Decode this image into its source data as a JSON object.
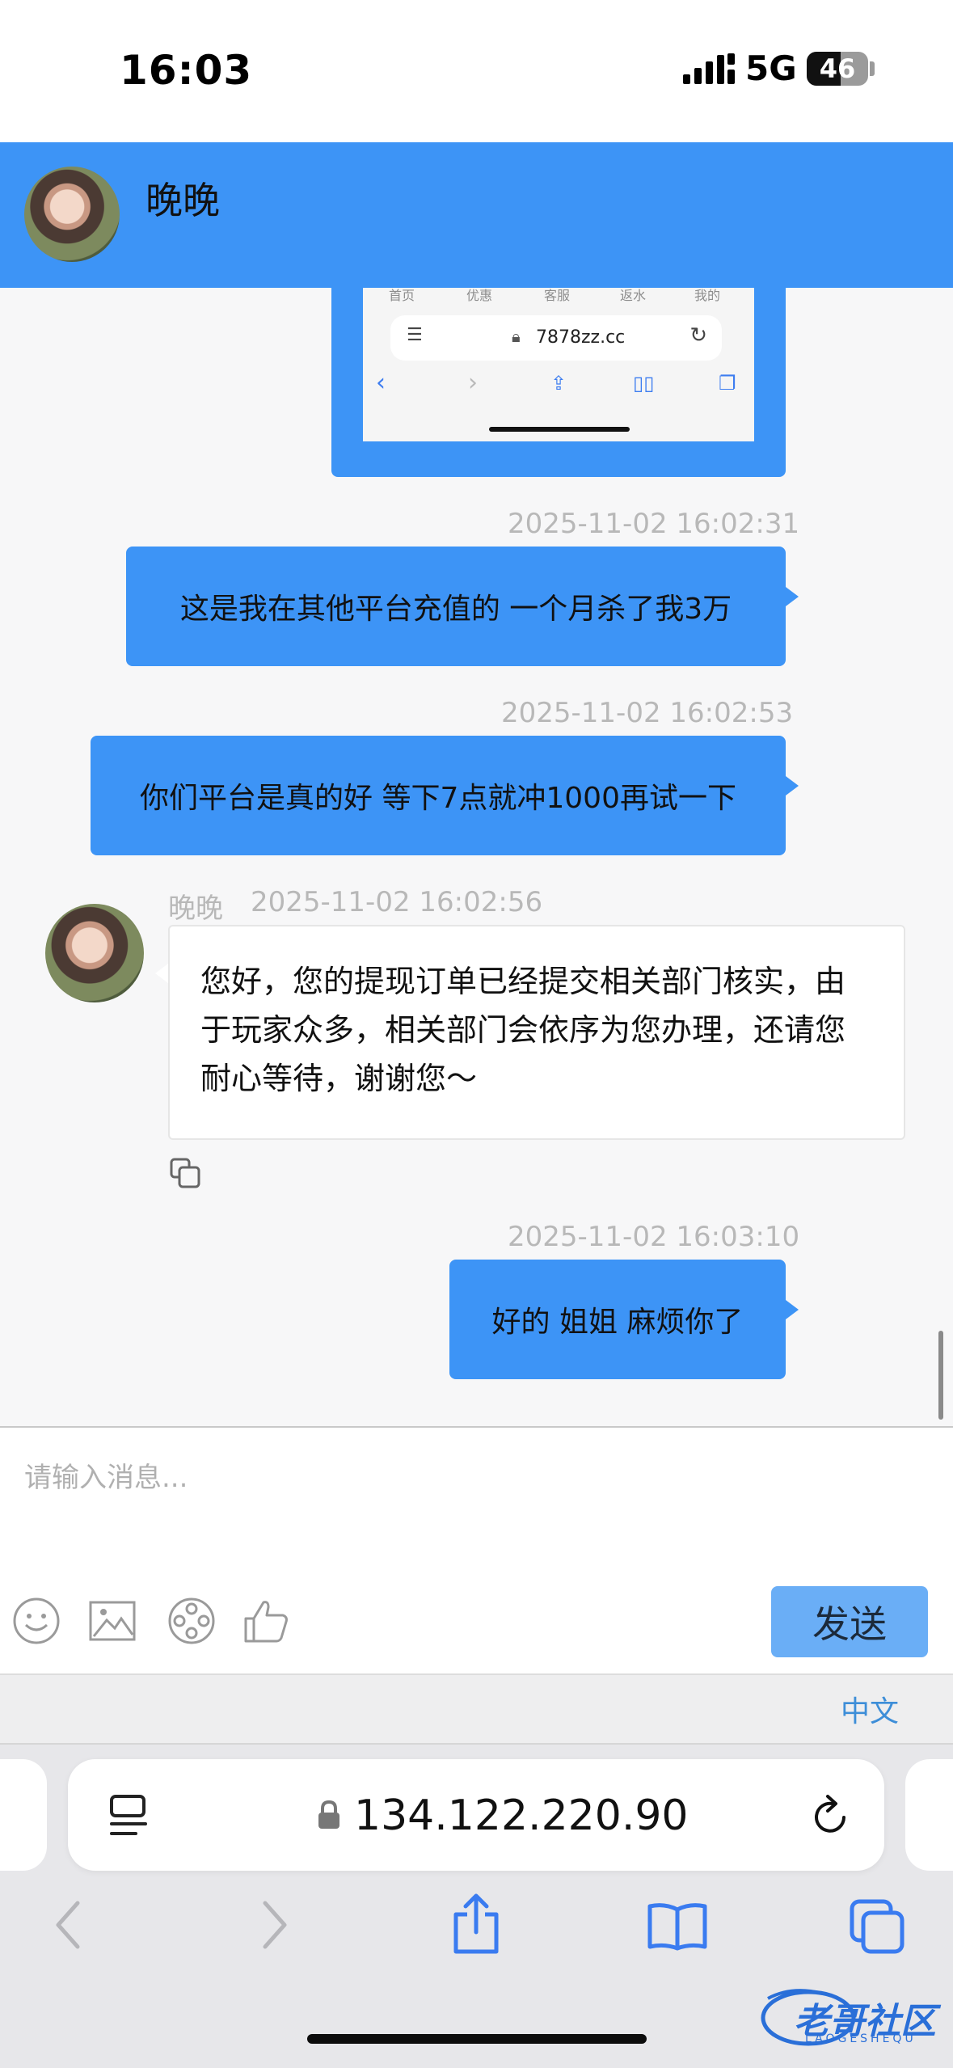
{
  "status_bar": {
    "time": "16:03",
    "network": "5G",
    "battery": "46"
  },
  "chat_header": {
    "contact_name": "晚晚"
  },
  "image_message": {
    "tabs": [
      "首页",
      "优惠",
      "客服",
      "返水",
      "我的"
    ],
    "url": "7878zz.cc"
  },
  "messages": [
    {
      "direction": "out",
      "timestamp": "2025-11-02 16:02:31",
      "text": "这是我在其他平台充值的 一个月杀了我3万"
    },
    {
      "direction": "out",
      "timestamp": "2025-11-02 16:02:53",
      "text": "你们平台是真的好 等下7点就冲1000再试一下"
    },
    {
      "direction": "in",
      "sender": "晚晚",
      "timestamp": "2025-11-02 16:02:56",
      "lines": [
        "您好，您的提现订单已经提交相关部门核实，由",
        "于玩家众多，相关部门会依序为您办理，还请您",
        "耐心等待，谢谢您～"
      ]
    },
    {
      "direction": "out",
      "timestamp": "2025-11-02 16:03:10",
      "text": "好的 姐姐 麻烦你了"
    }
  ],
  "composer": {
    "placeholder": "请输入消息...",
    "send_label": "发送",
    "tool_icons": [
      "emoji-icon",
      "image-icon",
      "video-icon",
      "thumbs-up-icon"
    ]
  },
  "language": {
    "label": "中文"
  },
  "browser": {
    "url": "134.122.220.90"
  },
  "watermark": {
    "text": "老哥社区",
    "sub": "LAOGESHEQU"
  },
  "colors": {
    "accent": "#3d94f6",
    "send_button": "#6aaef6",
    "link": "#3d8ed8"
  }
}
